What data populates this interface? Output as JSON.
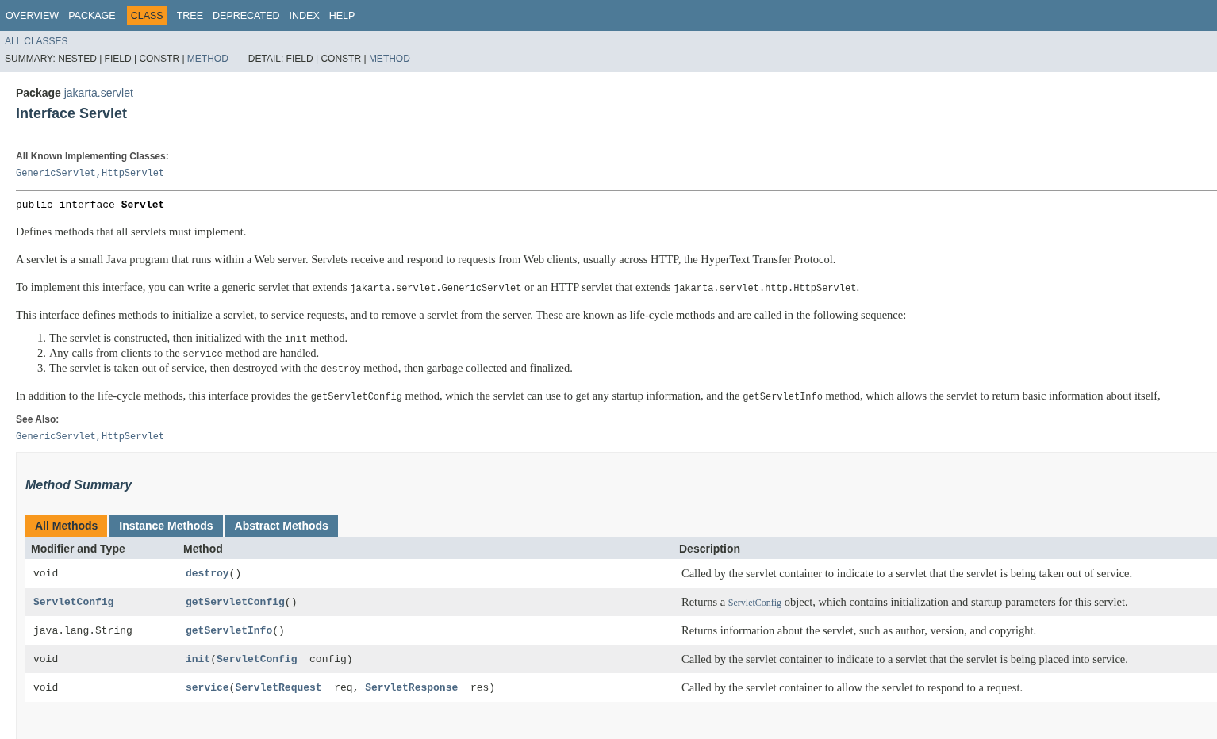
{
  "top_nav": {
    "items": [
      {
        "label": "OVERVIEW",
        "selected": false
      },
      {
        "label": "PACKAGE",
        "selected": false
      },
      {
        "label": "CLASS",
        "selected": true
      },
      {
        "label": "TREE",
        "selected": false
      },
      {
        "label": "DEPRECATED",
        "selected": false
      },
      {
        "label": "INDEX",
        "selected": false
      },
      {
        "label": "HELP",
        "selected": false
      }
    ]
  },
  "sub_nav": {
    "all_classes": "ALL CLASSES",
    "summary": [
      {
        "kind": "plain",
        "text": "SUMMARY: NESTED | FIELD | CONSTR | "
      },
      {
        "kind": "link",
        "text": "METHOD"
      }
    ],
    "detail": [
      {
        "kind": "plain",
        "text": "DETAIL: FIELD | CONSTR | "
      },
      {
        "kind": "link",
        "text": "METHOD"
      }
    ]
  },
  "header": {
    "package_label": "Package",
    "package_name": "jakarta.servlet",
    "title": "Interface Servlet"
  },
  "implementing": {
    "label": "All Known Implementing Classes:",
    "links": [
      "GenericServlet",
      "HttpServlet"
    ],
    "separator": ","
  },
  "signature": [
    {
      "kind": "plain",
      "text": "public interface "
    },
    {
      "kind": "bold",
      "text": "Servlet"
    }
  ],
  "paragraphs": [
    [
      {
        "kind": "plain",
        "text": "Defines methods that all servlets must implement."
      }
    ],
    [
      {
        "kind": "plain",
        "text": "A servlet is a small Java program that runs within a Web server. Servlets receive and respond to requests from Web clients, usually across HTTP, the HyperText Transfer Protocol."
      }
    ],
    [
      {
        "kind": "plain",
        "text": "To implement this interface, you can write a generic servlet that extends "
      },
      {
        "kind": "code",
        "text": "jakarta.servlet.GenericServlet"
      },
      {
        "kind": "plain",
        "text": " or an HTTP servlet that extends "
      },
      {
        "kind": "code",
        "text": "jakarta.servlet.http.HttpServlet"
      },
      {
        "kind": "plain",
        "text": "."
      }
    ],
    [
      {
        "kind": "plain",
        "text": "This interface defines methods to initialize a servlet, to service requests, and to remove a servlet from the server. These are known as life-cycle methods and are called in the following sequence:"
      }
    ]
  ],
  "sequence": [
    {
      "number": "1.",
      "parts": [
        {
          "kind": "plain",
          "text": "The servlet is constructed, then initialized with the "
        },
        {
          "kind": "code",
          "text": "init"
        },
        {
          "kind": "plain",
          "text": " method."
        }
      ]
    },
    {
      "number": "2.",
      "parts": [
        {
          "kind": "plain",
          "text": "Any calls from clients to the "
        },
        {
          "kind": "code",
          "text": "service"
        },
        {
          "kind": "plain",
          "text": " method are handled."
        }
      ]
    },
    {
      "number": "3.",
      "parts": [
        {
          "kind": "plain",
          "text": "The servlet is taken out of service, then destroyed with the "
        },
        {
          "kind": "code",
          "text": "destroy"
        },
        {
          "kind": "plain",
          "text": " method, then garbage collected and finalized."
        }
      ]
    }
  ],
  "closing_paragraph": [
    {
      "kind": "plain",
      "text": "In addition to the life-cycle methods, this interface provides the "
    },
    {
      "kind": "code",
      "text": "getServletConfig"
    },
    {
      "kind": "plain",
      "text": " method, which the servlet can use to get any startup information, and the "
    },
    {
      "kind": "code",
      "text": "getServletInfo"
    },
    {
      "kind": "plain",
      "text": " method, which allows the servlet to return basic information about itself,"
    }
  ],
  "see_also": {
    "label": "See Also:",
    "links": [
      "GenericServlet",
      "HttpServlet"
    ],
    "separator": ","
  },
  "method_summary": {
    "title": "Method Summary",
    "tabs": [
      {
        "label": "All Methods",
        "selected": true
      },
      {
        "label": "Instance Methods",
        "selected": false
      },
      {
        "label": "Abstract Methods",
        "selected": false
      }
    ],
    "columns": [
      "Modifier and Type",
      "Method",
      "Description"
    ],
    "rows": [
      {
        "type": [
          {
            "kind": "plain",
            "text": "void"
          }
        ],
        "method": [
          {
            "kind": "link",
            "text": "destroy"
          },
          {
            "kind": "plain",
            "text": "()"
          }
        ],
        "description": [
          {
            "kind": "plain",
            "text": "Called by the servlet container to indicate to a servlet that the servlet is being taken out of service."
          }
        ]
      },
      {
        "type": [
          {
            "kind": "link",
            "text": "ServletConfig"
          }
        ],
        "method": [
          {
            "kind": "link",
            "text": "getServletConfig"
          },
          {
            "kind": "plain",
            "text": "()"
          }
        ],
        "description": [
          {
            "kind": "plain",
            "text": "Returns a "
          },
          {
            "kind": "link",
            "text": "ServletConfig"
          },
          {
            "kind": "plain",
            "text": " object, which contains initialization and startup parameters for this servlet."
          }
        ]
      },
      {
        "type": [
          {
            "kind": "plain",
            "text": "java.lang.String"
          }
        ],
        "method": [
          {
            "kind": "link",
            "text": "getServletInfo"
          },
          {
            "kind": "plain",
            "text": "()"
          }
        ],
        "description": [
          {
            "kind": "plain",
            "text": "Returns information about the servlet, such as author, version, and copyright."
          }
        ]
      },
      {
        "type": [
          {
            "kind": "plain",
            "text": "void"
          }
        ],
        "method": [
          {
            "kind": "link",
            "text": "init"
          },
          {
            "kind": "plain",
            "text": "("
          },
          {
            "kind": "link",
            "text": "ServletConfig"
          },
          {
            "kind": "plain",
            "text": "  config)"
          }
        ],
        "description": [
          {
            "kind": "plain",
            "text": "Called by the servlet container to indicate to a servlet that the servlet is being placed into service."
          }
        ]
      },
      {
        "type": [
          {
            "kind": "plain",
            "text": "void"
          }
        ],
        "method": [
          {
            "kind": "link",
            "text": "service"
          },
          {
            "kind": "plain",
            "text": "("
          },
          {
            "kind": "link",
            "text": "ServletRequest"
          },
          {
            "kind": "plain",
            "text": "  req, "
          },
          {
            "kind": "link",
            "text": "ServletResponse"
          },
          {
            "kind": "plain",
            "text": "  res)"
          }
        ],
        "description": [
          {
            "kind": "plain",
            "text": "Called by the servlet container to allow the servlet to respond to a request."
          }
        ]
      }
    ]
  }
}
